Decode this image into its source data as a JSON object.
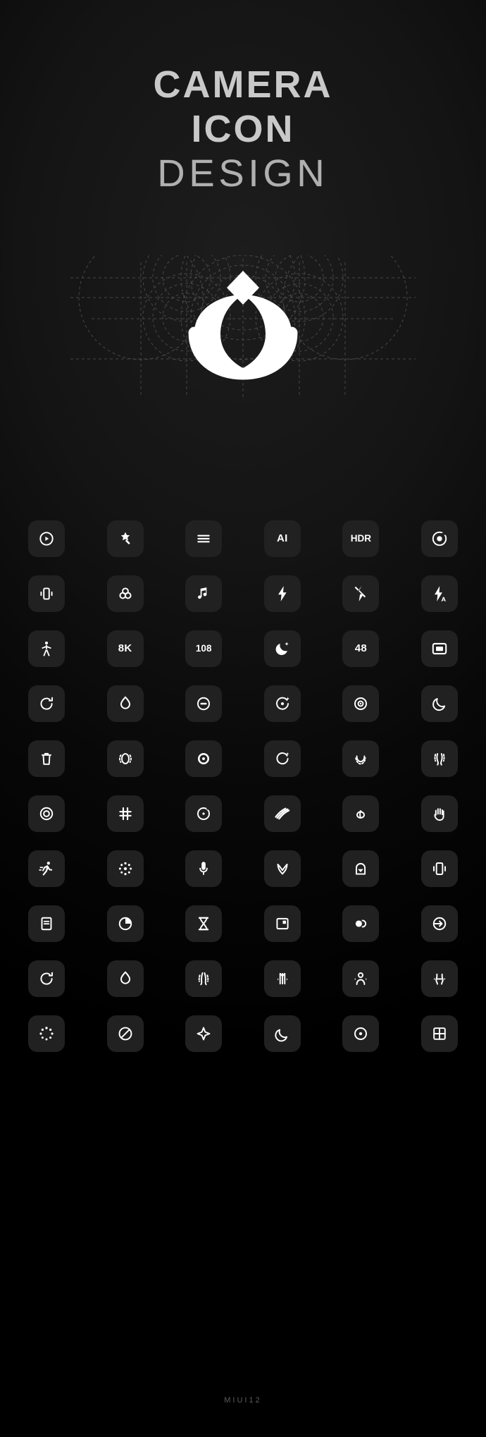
{
  "header": {
    "line1": "CAMERA",
    "line2": "ICON",
    "line3": "DESIGN"
  },
  "logo": {
    "name": "camera-lotus-logo",
    "description": "MIUI camera lotus mark on dashed golden-ratio construction grid",
    "mark_color": "#ffffff",
    "guide_color": "#6a6a6a"
  },
  "footer": {
    "label": "MIUI12"
  },
  "theme": {
    "background": "#000000",
    "tile_background": "#212121",
    "icon_color": "#ffffff",
    "title_color": "#c9c9c9",
    "footer_color": "#5c5c5c"
  },
  "grid": {
    "columns": 6,
    "rows": 10,
    "icons": [
      {
        "name": "shutter-play-icon",
        "label": ""
      },
      {
        "name": "magic-wand-icon",
        "label": ""
      },
      {
        "name": "menu-hamburger-icon",
        "label": ""
      },
      {
        "name": "ai-label-icon",
        "label": "AI"
      },
      {
        "name": "hdr-label-icon",
        "label": "HDR"
      },
      {
        "name": "focus-target-icon",
        "label": ""
      },
      {
        "name": "vibrate-phone-icon",
        "label": ""
      },
      {
        "name": "color-filters-icon",
        "label": ""
      },
      {
        "name": "music-note-icon",
        "label": ""
      },
      {
        "name": "flash-on-icon",
        "label": ""
      },
      {
        "name": "flash-off-icon",
        "label": ""
      },
      {
        "name": "flash-auto-icon",
        "label": ""
      },
      {
        "name": "person-pose-icon",
        "label": ""
      },
      {
        "name": "resolution-8k-icon",
        "label": "8K"
      },
      {
        "name": "resolution-108-icon",
        "label": "108"
      },
      {
        "name": "night-mode-icon",
        "label": ""
      },
      {
        "name": "resolution-48-icon",
        "label": "48"
      },
      {
        "name": "frame-crop-icon",
        "label": ""
      },
      {
        "name": "rotate-refresh-icon",
        "label": ""
      },
      {
        "name": "water-drop-icon",
        "label": ""
      },
      {
        "name": "eye-aperture-icon",
        "label": ""
      },
      {
        "name": "aperture-sparkle-icon",
        "label": ""
      },
      {
        "name": "focus-ring-icon",
        "label": ""
      },
      {
        "name": "moon-crescent-icon",
        "label": ""
      },
      {
        "name": "trash-delete-icon",
        "label": ""
      },
      {
        "name": "slim-body-icon",
        "label": ""
      },
      {
        "name": "dot-aperture-icon",
        "label": ""
      },
      {
        "name": "rotate-sparkle-icon",
        "label": ""
      },
      {
        "name": "smile-curve-icon",
        "label": ""
      },
      {
        "name": "waist-slim-icon",
        "label": ""
      },
      {
        "name": "lens-target-icon",
        "label": ""
      },
      {
        "name": "grid-hash-icon",
        "label": ""
      },
      {
        "name": "center-dot-icon",
        "label": ""
      },
      {
        "name": "motion-lines-icon",
        "label": ""
      },
      {
        "name": "tulip-flower-icon",
        "label": ""
      },
      {
        "name": "hand-palm-icon",
        "label": ""
      },
      {
        "name": "running-person-icon",
        "label": ""
      },
      {
        "name": "sparkle-dots-icon",
        "label": ""
      },
      {
        "name": "microphone-icon",
        "label": ""
      },
      {
        "name": "beauty-heart-icon",
        "label": ""
      },
      {
        "name": "arch-badge-icon",
        "label": ""
      },
      {
        "name": "phone-vibrate-icon",
        "label": ""
      },
      {
        "name": "document-scan-icon",
        "label": ""
      },
      {
        "name": "contrast-pie-icon",
        "label": ""
      },
      {
        "name": "hourglass-timer-icon",
        "label": ""
      },
      {
        "name": "picture-in-picture-icon",
        "label": ""
      },
      {
        "name": "dual-circle-icon",
        "label": ""
      },
      {
        "name": "exposure-arrow-icon",
        "label": ""
      },
      {
        "name": "rotate-refresh-alt-icon",
        "label": ""
      },
      {
        "name": "water-drop-alt-icon",
        "label": ""
      },
      {
        "name": "legs-slim-icon",
        "label": ""
      },
      {
        "name": "body-stretch-icon",
        "label": ""
      },
      {
        "name": "shoulder-slim-icon",
        "label": ""
      },
      {
        "name": "hip-slim-icon",
        "label": ""
      },
      {
        "name": "loading-dots-icon",
        "label": ""
      },
      {
        "name": "no-entry-icon",
        "label": ""
      },
      {
        "name": "sparkle-star-icon",
        "label": ""
      },
      {
        "name": "moon-phase-icon",
        "label": ""
      },
      {
        "name": "aperture-dot-icon",
        "label": ""
      },
      {
        "name": "grid-four-icon",
        "label": ""
      }
    ]
  }
}
